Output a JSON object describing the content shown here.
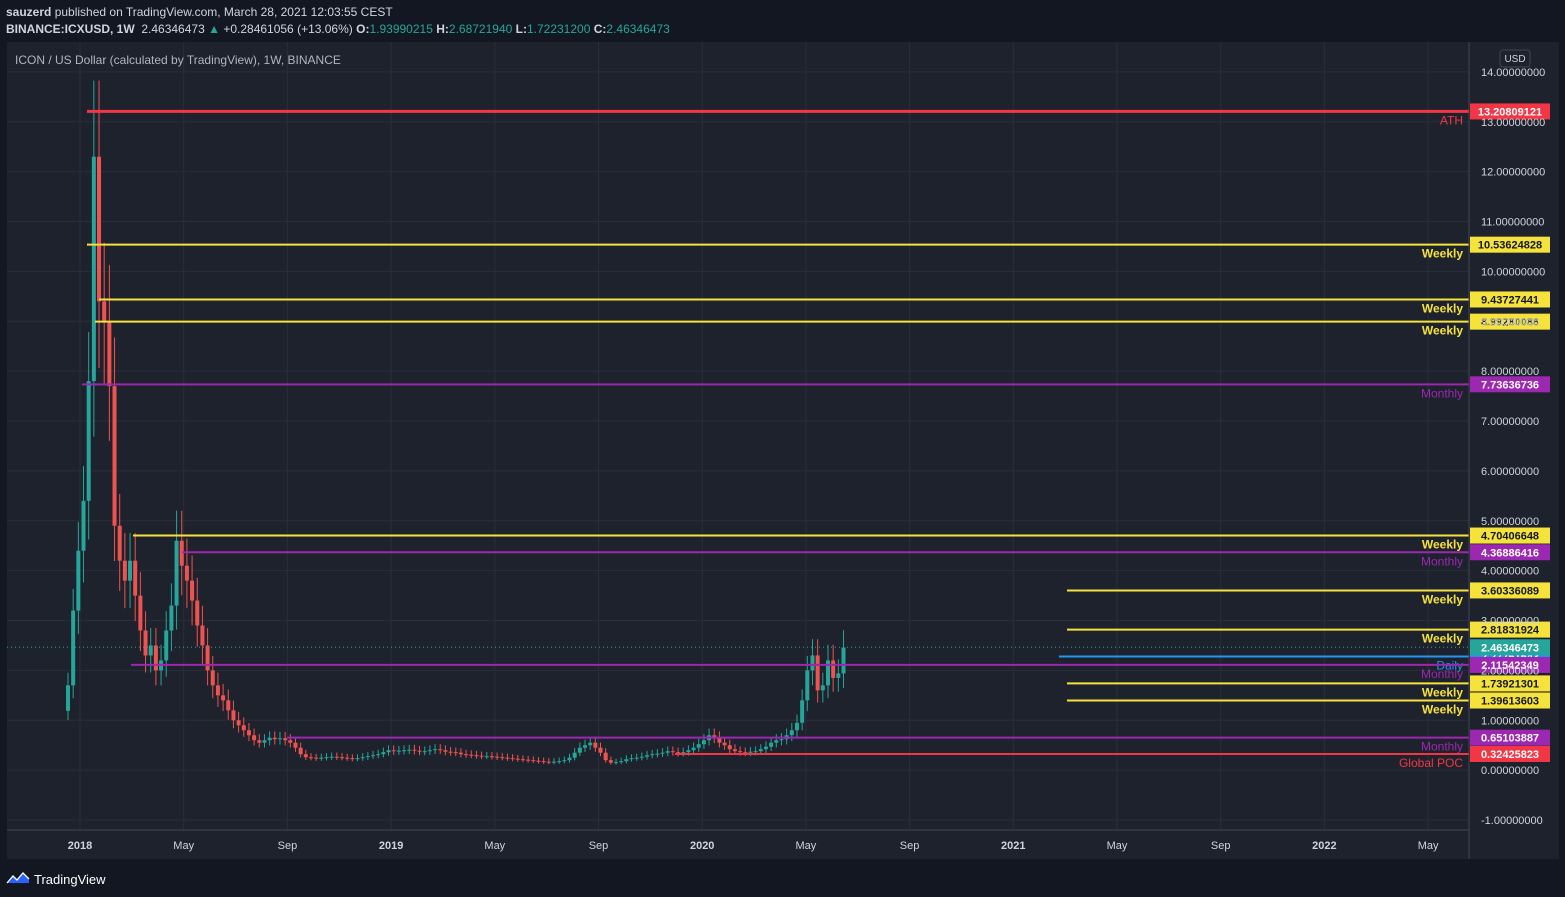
{
  "header": {
    "author": "sauzerd",
    "published": "published on TradingView.com, March 28, 2021 12:03:55 CEST",
    "symbol": "BINANCE:ICXUSD, 1W",
    "last": "2.46346473",
    "change_arrow": "▲",
    "change": "+0.28461056 (+13.06%)",
    "o_label": "O:",
    "o": "1.93990215",
    "h_label": "H:",
    "h": "2.68721940",
    "l_label": "L:",
    "l": "1.72231200",
    "c_label": "C:",
    "c": "2.46346473"
  },
  "chart_title": "ICON / US Dollar (calculated by TradingView), 1W, BINANCE",
  "currency_button": "USD",
  "footer": {
    "brand": "TradingView",
    "logo_icon": "tradingview-logo-icon"
  },
  "colors": {
    "background": "#131722",
    "panel": "#1e222d",
    "up": "#26a69a",
    "down": "#ef5350",
    "red_line": "#f23645",
    "weekly": "#f5e33b",
    "monthly": "#9c27b0",
    "daily": "#2196f3",
    "last_price": "#26a69a"
  },
  "chart_data": {
    "type": "candlestick",
    "y_scale": "linear",
    "ylim": [
      -1.2,
      14.6
    ],
    "y_ticks": [
      "14.00000000",
      "13.00000000",
      "12.00000000",
      "11.00000000",
      "10.00000000",
      "9.00000000",
      "8.00000000",
      "7.00000000",
      "6.00000000",
      "5.00000000",
      "4.00000000",
      "3.00000000",
      "2.00000000",
      "1.00000000",
      "0.00000000",
      "-1.00000000"
    ],
    "x_ticks": [
      "2018",
      "May",
      "Sep",
      "2019",
      "May",
      "Sep",
      "2020",
      "May",
      "Sep",
      "2021",
      "May",
      "Sep",
      "2022",
      "May"
    ],
    "candle_closes_weekly": [
      1.7,
      3.2,
      4.4,
      5.4,
      7.8,
      12.3,
      9.4,
      9.0,
      7.7,
      4.9,
      4.2,
      3.8,
      4.2,
      3.5,
      2.8,
      2.3,
      2.5,
      2.0,
      2.2,
      2.8,
      3.3,
      4.6,
      4.1,
      3.8,
      3.4,
      2.9,
      2.5,
      2.0,
      1.7,
      1.5,
      1.4,
      1.2,
      1.0,
      0.9,
      0.8,
      0.7,
      0.6,
      0.55,
      0.6,
      0.65,
      0.62,
      0.64,
      0.6,
      0.55,
      0.45,
      0.32,
      0.26,
      0.25,
      0.24,
      0.25,
      0.26,
      0.27,
      0.26,
      0.25,
      0.24,
      0.23,
      0.24,
      0.26,
      0.28,
      0.3,
      0.32,
      0.36,
      0.4,
      0.38,
      0.39,
      0.4,
      0.41,
      0.39,
      0.37,
      0.38,
      0.4,
      0.42,
      0.4,
      0.37,
      0.36,
      0.35,
      0.32,
      0.31,
      0.3,
      0.29,
      0.28,
      0.28,
      0.27,
      0.26,
      0.25,
      0.24,
      0.23,
      0.22,
      0.21,
      0.2,
      0.19,
      0.18,
      0.17,
      0.16,
      0.17,
      0.18,
      0.2,
      0.25,
      0.35,
      0.45,
      0.5,
      0.55,
      0.45,
      0.35,
      0.2,
      0.15,
      0.16,
      0.18,
      0.22,
      0.24,
      0.25,
      0.27,
      0.3,
      0.32,
      0.33,
      0.35,
      0.38,
      0.36,
      0.34,
      0.36,
      0.4,
      0.45,
      0.52,
      0.6,
      0.7,
      0.65,
      0.55,
      0.5,
      0.42,
      0.38,
      0.36,
      0.35,
      0.37,
      0.38,
      0.42,
      0.47,
      0.55,
      0.6,
      0.62,
      0.7,
      0.8,
      0.95,
      1.4,
      2.0,
      2.3,
      1.6,
      1.7,
      2.2,
      1.85,
      1.94,
      2.46
    ],
    "horizontal_levels": [
      {
        "value": 13.20809121,
        "price_label": "13.20809121",
        "tag": "ATH",
        "type": "ath"
      },
      {
        "value": 10.53624828,
        "price_label": "10.53624828",
        "tag": "Weekly",
        "type": "weekly"
      },
      {
        "value": 9.43727441,
        "price_label": "9.43727441",
        "tag": "Weekly",
        "type": "weekly"
      },
      {
        "value": 8.99280086,
        "price_label": "8.99280086",
        "tag": "Weekly",
        "type": "weekly"
      },
      {
        "value": 7.73636736,
        "price_label": "7.73636736",
        "tag": "Monthly",
        "type": "monthly"
      },
      {
        "value": 4.70406648,
        "price_label": "4.70406648",
        "tag": "Weekly",
        "type": "weekly"
      },
      {
        "value": 4.36886416,
        "price_label": "4.36886416",
        "tag": "Monthly",
        "type": "monthly"
      },
      {
        "value": 3.60336089,
        "price_label": "3.60336089",
        "tag": "Weekly",
        "type": "weekly"
      },
      {
        "value": 2.81831924,
        "price_label": "2.81831924",
        "tag": "Weekly",
        "type": "weekly"
      },
      {
        "value": 2.27761543,
        "price_label": "2.27761543",
        "tag": "Daily",
        "type": "daily"
      },
      {
        "value": 2.11,
        "price_label": "2.11542349",
        "tag": "Monthly",
        "type": "monthly"
      },
      {
        "value": 1.73921301,
        "price_label": "1.73921301",
        "tag": "Weekly",
        "type": "weekly"
      },
      {
        "value": 1.39613603,
        "price_label": "1.39613603",
        "tag": "Weekly",
        "type": "weekly"
      },
      {
        "value": 0.65103887,
        "price_label": "0.65103887",
        "tag": "Monthly",
        "type": "monthly"
      },
      {
        "value": 0.32425823,
        "price_label": "0.32425823",
        "tag": "Global POC",
        "type": "poc"
      }
    ],
    "last_price": {
      "value": 2.46346473,
      "price_label": "2.46346473"
    }
  }
}
